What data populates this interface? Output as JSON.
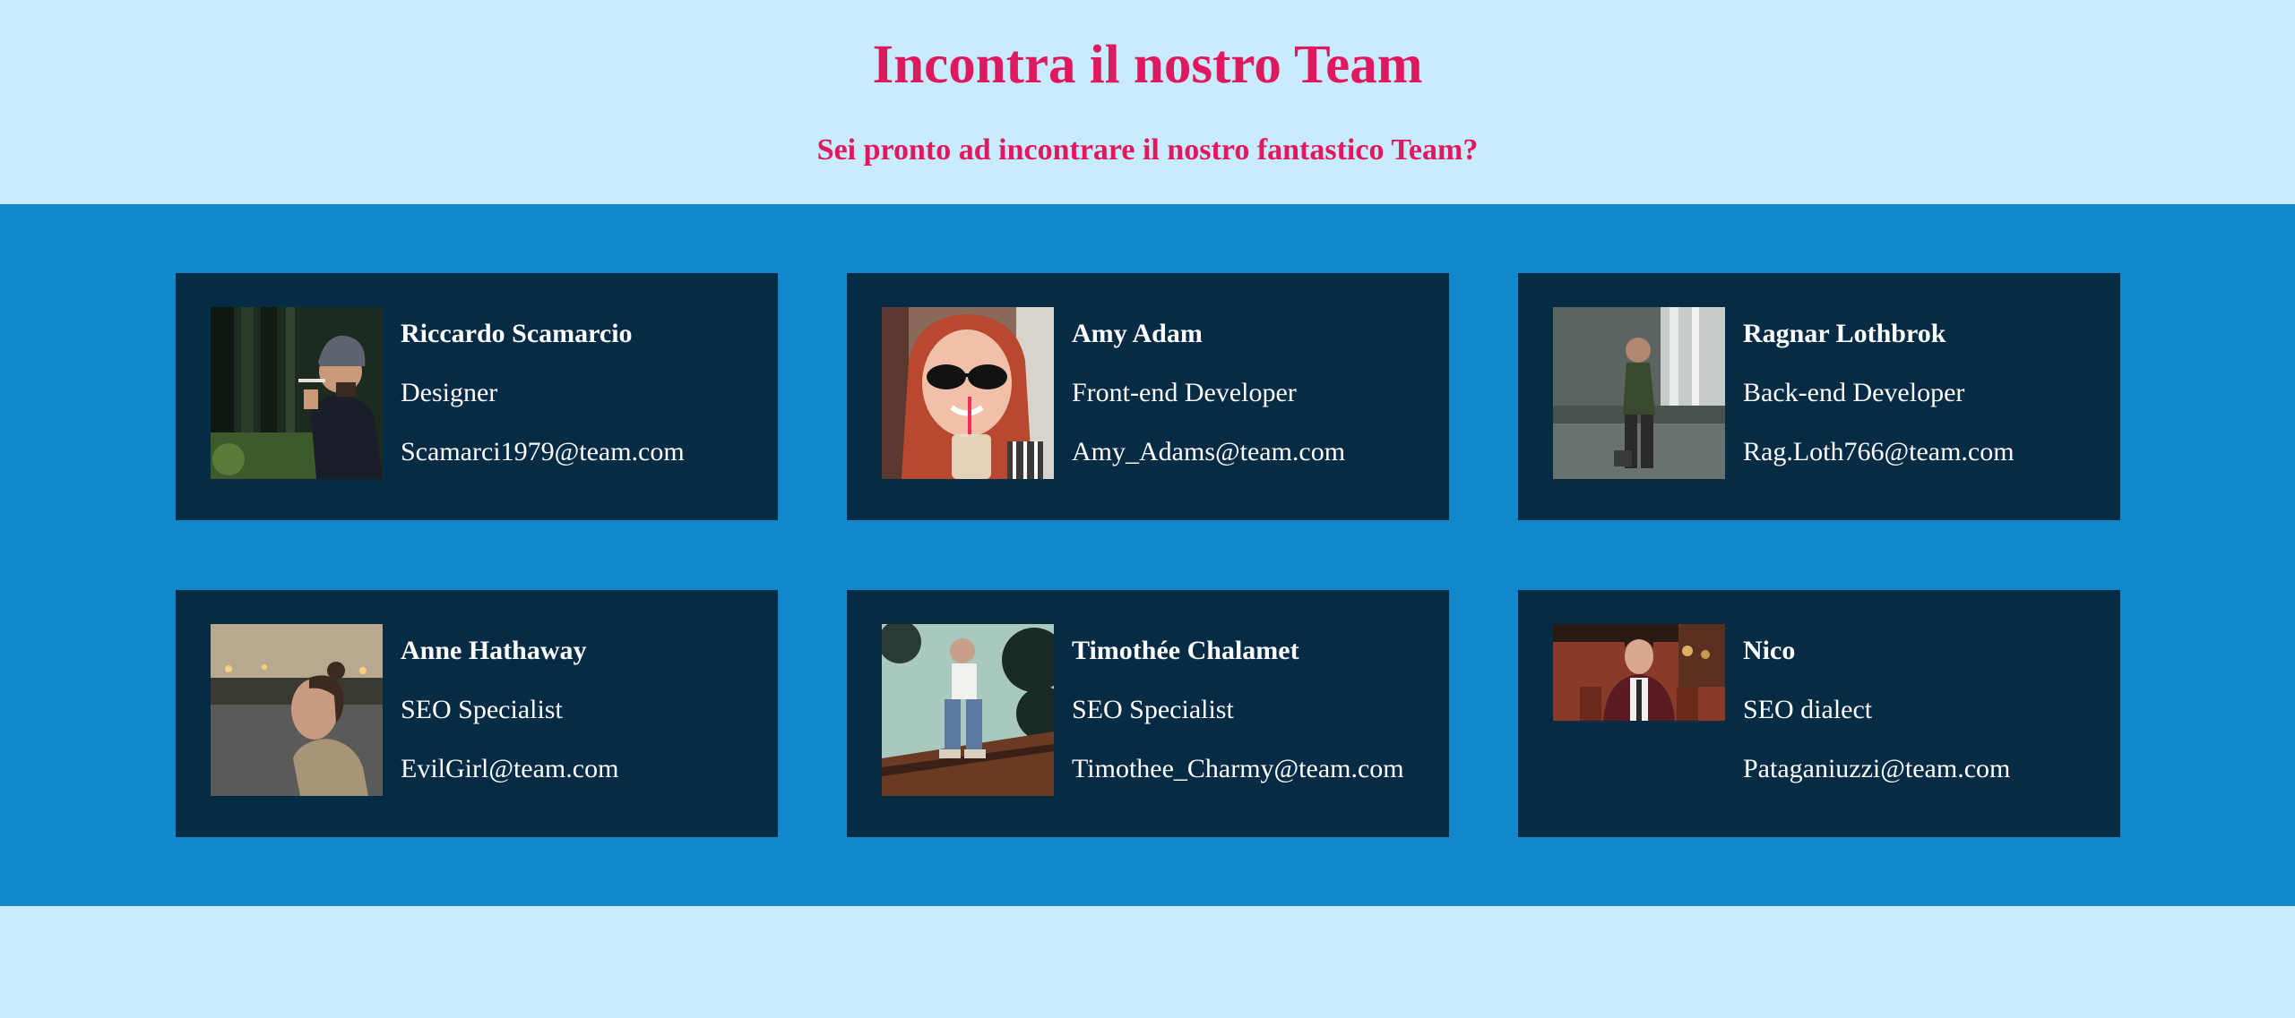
{
  "header": {
    "title": "Incontra il nostro Team",
    "subtitle": "Sei pronto ad incontrare il nostro fantastico Team?"
  },
  "colors": {
    "accent": "#e0195f",
    "page_background": "#c8ebfd",
    "band_background": "#1287cb",
    "card_background": "#062b45",
    "text": "#ffffff"
  },
  "team": [
    {
      "name": "Riccardo Scamarcio",
      "role": "Designer",
      "email": "Scamarci1979@team.com",
      "photo": "man-smoking-in-forest-photo"
    },
    {
      "name": "Amy Adam",
      "role": "Front-end Developer",
      "email": "Amy_Adams@team.com",
      "photo": "woman-with-sunglasses-and-drink-photo"
    },
    {
      "name": "Ragnar Lothbrok",
      "role": "Back-end Developer",
      "email": "Rag.Loth766@team.com",
      "photo": "man-at-waterfall-photo"
    },
    {
      "name": "Anne Hathaway",
      "role": "SEO Specialist",
      "email": "EvilGirl@team.com",
      "photo": "woman-by-lake-photo"
    },
    {
      "name": "Timothée Chalamet",
      "role": "SEO Specialist",
      "email": "Timothee_Charmy@team.com",
      "photo": "man-sitting-on-roof-photo"
    },
    {
      "name": "Nico",
      "role": "SEO dialect",
      "email": "Pataganiuzzi@team.com",
      "photo": "man-in-red-jacket-photo"
    }
  ]
}
